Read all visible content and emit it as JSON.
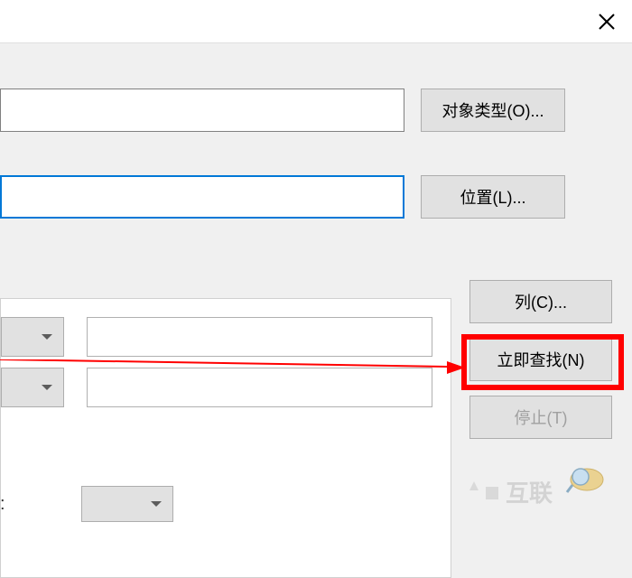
{
  "titlebar": {
    "close_label": "关闭"
  },
  "upper": {
    "field1_value": "",
    "object_type_btn": "对象类型(O)...",
    "field2_value": "",
    "location_btn": "位置(L)..."
  },
  "search": {
    "row1_value": "",
    "row2_value": ""
  },
  "actions": {
    "columns_btn": "列(C)...",
    "find_now_btn": "立即查找(N)",
    "stop_btn": "停止(T)"
  },
  "bottom": {
    "label": ":"
  },
  "watermark": {
    "text": "互联"
  }
}
